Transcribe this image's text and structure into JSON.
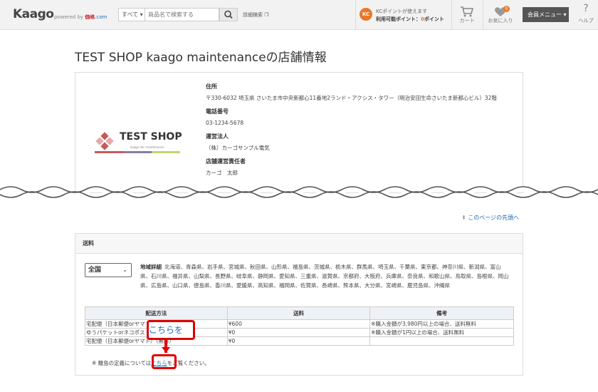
{
  "header": {
    "logo": "Kaago",
    "logo_powered": "powered by",
    "logo_kakaku": "価格",
    "logo_com": ".com",
    "category_select": "すべて ▾",
    "search_placeholder": "商品名で検索する",
    "advanced_search": "詳細検索",
    "kc_icon": "KC",
    "kc_line1": "KCポイントが使えます",
    "kc_line2_prefix": "利用可能ポイント：",
    "kc_points": "0",
    "kc_line2_suffix": "ポイント",
    "cart_label": "カート",
    "favorites_label": "お気に入り",
    "favorites_badge": "0",
    "member_menu": "会員メニュー ▾",
    "help_label": "ヘルプ",
    "help_glyph": "?"
  },
  "page": {
    "title": "TEST SHOP kaago maintenanceの店舗情報",
    "page_top_link": "このページの先頭へ"
  },
  "shop_logo": {
    "name": "TEST SHOP",
    "sub": "kaago der maintenance"
  },
  "info": [
    {
      "label": "住所",
      "value": "〒330-6032 埼玉県 さいたま市中央新都心11番地2ランド・アクシス・タワー（明治安田生命さいたま新都心ビル）32階"
    },
    {
      "label": "電話番号",
      "value": "03-1234-5678"
    },
    {
      "label": "運営法人",
      "value": "（株）カーゴサンプル電気"
    },
    {
      "label": "店舗運営責任者",
      "value": "カーゴ　太郎"
    }
  ],
  "shipping": {
    "heading": "送料",
    "region_select": "全国",
    "region_label": "地域詳細",
    "region_list": "北海道、青森県、岩手県、宮城県、秋田県、山形県、福島県、茨城県、栃木県、群馬県、埼玉県、千葉県、東京都、神奈川県、新潟県、富山県、石川県、福井県、山梨県、長野県、岐阜県、静岡県、愛知県、三重県、滋賀県、京都府、大阪府、兵庫県、奈良県、和歌山県、鳥取県、島根県、岡山県、広島県、山口県、徳島県、香川県、愛媛県、高知県、福岡県、佐賀県、長崎県、熊本県、大分県、宮崎県、鹿児島県、沖縄県",
    "columns": [
      "配送方法",
      "送料",
      "備考"
    ],
    "rows": [
      [
        "宅配便（日本郵便orヤマト）",
        "¥600",
        "※購入金額が3,980円以上の場合、送料無料"
      ],
      [
        "ゆうパケットorネコポス",
        "¥0",
        "※購入金額が1円以上の場合、送料無料"
      ],
      [
        "宅配便（日本郵便orヤマト）（無料）",
        "¥0",
        ""
      ]
    ],
    "note_prefix": "※ 離島の定義については",
    "note_link": "こちら",
    "note_suffix": "をご覧ください。"
  },
  "callout": {
    "text": "こちらを"
  }
}
